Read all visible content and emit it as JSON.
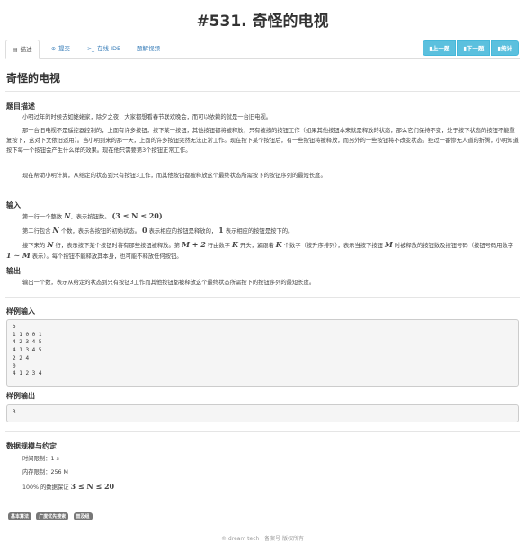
{
  "page": {
    "title": "#531. 奇怪的电视"
  },
  "tabs": [
    {
      "icon": "▤",
      "label": "描述"
    },
    {
      "icon": "⊕",
      "label": "提交"
    },
    {
      "icon": ">_",
      "label": "在线 IDE"
    },
    {
      "icon": "",
      "label": "题解视频"
    }
  ],
  "buttons": {
    "prev": "▮上一题",
    "next": "▮下一题",
    "stats": "▮统计"
  },
  "problem": {
    "name": "奇怪的电视"
  },
  "sections": {
    "description_title": "题目描述",
    "input_title": "输入",
    "output_title": "输出",
    "sample_input_title": "样例输入",
    "sample_output_title": "样例输出",
    "limits_title": "数据规模与约定"
  },
  "description": {
    "p1": "小明过年的时候去如姥姥家，除夕之夜，大家都想看春节联欢晚会，而可以依赖的就是一台旧电视。",
    "p2": "那一台旧电视不是遥控器控制的，上面有许多按钮，按下某一按钮，其他按钮都将被释放，只有被按的按钮工作（如果其他按钮本来就是释放的状态，那么它们保持不变，处于按下状态的按钮不能重复按下，这对下文依旧适用）。当小明到来的那一天，上面的许多按钮突然无法正常工作。现在按下某个按钮后，有一些按钮将被释放，而另外的一些按钮将不改变状态。经过一番惨无人道的折腾，小明知道按下每一个按钮会产生什么样的效果。现在他只需要第3个按钮正常工作。",
    "p3": "现在帮助小明计算，从给定的状态到只有按钮3工作，而其他按钮都被释放这个最终状态所需按下的按钮序列的最短长度。"
  },
  "input": {
    "l1_a": "第一行一个整数",
    "l1_var": "N",
    "l1_b": "，表示按钮数。",
    "l1_range": "(3 ≤ N ≤ 20)",
    "l2_a": "第二行包含",
    "l2_var": "N",
    "l2_b": "个数，表示各按钮的初始状态。",
    "l2_zero": "0",
    "l2_c": "表示相应的按钮是释放的，",
    "l2_one": "1",
    "l2_d": "表示相应的按钮是按下的。",
    "l3_a": "接下来的",
    "l3_var": "N",
    "l3_b": "行，表示按下某个按钮时将有那些按钮被释放。第",
    "l3_expr": "M + 2",
    "l3_c": "行由数字",
    "l3_k": "K",
    "l3_d": "开头，紧跟着",
    "l3_k2": "K",
    "l3_e": "个数字（按升序排列），表示当按下按钮",
    "l3_m": "M",
    "l3_f": "时被释放的按钮数及按钮号码（按钮号码用数字",
    "l3_range": "1 ∼ M",
    "l3_g": "表示）。每个按钮不能释放其本身，也可能不释放任何按钮。"
  },
  "output": {
    "text": "输出一个数，表示从给定的状态到只有按钮3工作而其他按钮都被释放这个最终状态所需按下的按钮序列的最短长度。"
  },
  "sample_input": "5\n1 1 0 0 1\n4 2 3 4 5\n4 1 3 4 5\n2 2 4\n0\n4 1 2 3 4",
  "sample_output": "3",
  "limits": {
    "time_label": "时间限制：1 s",
    "memory_label": "内存限制：256 M",
    "guarantee_a": "100% 的数据保证",
    "guarantee_range": "3 ≤ N ≤ 20"
  },
  "tags": [
    "基本算法",
    "广度优先搜索",
    "普及组"
  ],
  "footer": "© dream tech · 备案号·版权所有"
}
